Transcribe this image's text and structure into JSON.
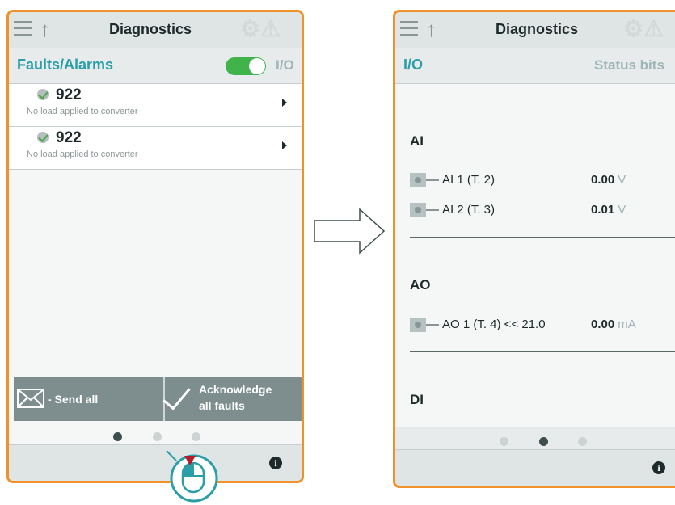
{
  "left_screen": {
    "title": "Diagnostics",
    "tabs": {
      "active": "Faults/Alarms",
      "inactive": "I/O"
    },
    "toggle_on": true,
    "faults": [
      {
        "code": "922",
        "description": "No load applied to converter"
      },
      {
        "code": "922",
        "description": "No load applied to converter"
      }
    ],
    "actions": {
      "send_all": "- Send all",
      "ack_line1": "Acknowledge",
      "ack_line2": "all faults"
    },
    "page_dots": {
      "count": 3,
      "active_index": 0
    }
  },
  "right_screen": {
    "title": "Diagnostics",
    "tabs": {
      "active": "I/O",
      "inactive": "Status bits"
    },
    "sections": [
      {
        "name": "AI",
        "rows": [
          {
            "label": "AI 1 (T. 2)",
            "value": "0.00",
            "unit": "V"
          },
          {
            "label": "AI 2 (T. 3)",
            "value": "0.01",
            "unit": "V"
          }
        ]
      },
      {
        "name": "AO",
        "rows": [
          {
            "label": "AO 1 (T. 4) << 21.0",
            "value": "0.00",
            "unit": "mA"
          }
        ]
      },
      {
        "name": "DI",
        "rows": []
      }
    ],
    "page_dots": {
      "count": 3,
      "active_index": 1
    }
  },
  "icons": {
    "menu": "hamburger-icon",
    "back": "up-arrow-icon",
    "info": "info-icon",
    "fault_status": "fault-acknowledged-icon",
    "send": "envelope-icon",
    "acknowledge": "checkmark-icon",
    "transition": "right-arrow-icon",
    "cursor": "mouse-click-icon"
  },
  "colors": {
    "frame_orange": "#f0922b",
    "accent_teal": "#2b9ea8",
    "toggle_green": "#41b34b",
    "action_gray": "#7e8e8f"
  }
}
